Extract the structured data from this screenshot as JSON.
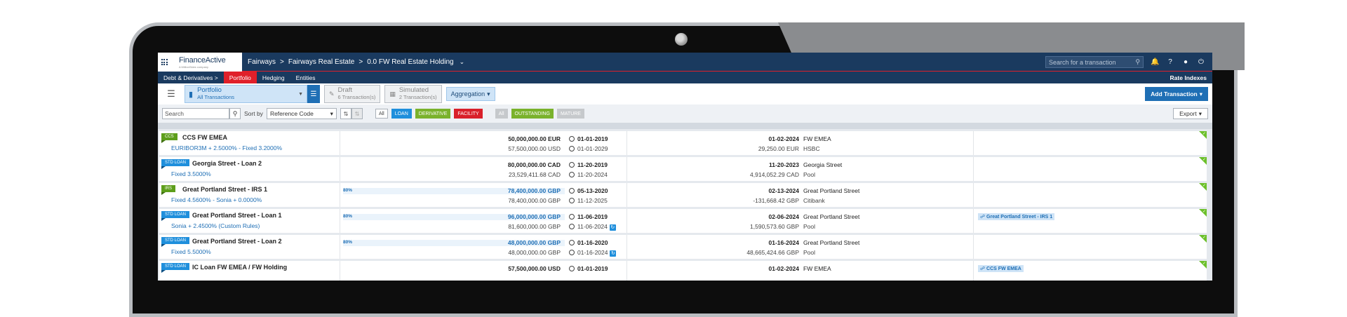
{
  "app": {
    "logo_main": "FinanceActive",
    "logo_sub": "A MillionSkies company"
  },
  "breadcrumb": [
    "Fairways",
    "Fairways Real Estate",
    "0.0 FW Real Estate Holding"
  ],
  "topbar": {
    "search_placeholder": "Search for a transaction"
  },
  "nav": {
    "items": [
      "Debt & Derivatives",
      "Portfolio",
      "Hedging",
      "Entities"
    ],
    "right": "Rate Indexes"
  },
  "toolbar": {
    "portfolio_title": "Portfolio",
    "portfolio_sub": "All Transactions",
    "draft_title": "Draft",
    "draft_sub": "6 Transaction(s)",
    "simulated_title": "Simulated",
    "simulated_sub": "2 Transaction(s)",
    "aggregation": "Aggregation",
    "add_transaction": "Add Transaction"
  },
  "filters": {
    "search_placeholder": "Search",
    "sort_label": "Sort by",
    "sort_value": "Reference Code",
    "type_chips": [
      "All",
      "LOAN",
      "DERIVATIVE",
      "FACILITY"
    ],
    "status_chips": [
      "All",
      "OUTSTANDING",
      "MATURE"
    ],
    "export": "Export"
  },
  "colors": {
    "navy": "#1a3a5f",
    "red": "#e0202a",
    "blue": "#1f6fb5",
    "green": "#6cc02a"
  },
  "rows": [
    {
      "badge": "CCS",
      "badge_color": "green",
      "name": "CCS FW EMEA",
      "rate": "EURIBOR3M + 2.5000% - Fixed 3.2000%",
      "pct": "",
      "amount1": "50,000,000.00 EUR",
      "amount2": "57,500,000.00 USD",
      "amount1_blue": false,
      "date1": "01-01-2019",
      "date2": "01-01-2029",
      "date2_refresh": false,
      "end1": "01-02-2024",
      "end2": "29,250.00 EUR",
      "cp1": "FW EMEA",
      "cp2": "HSBC",
      "link": ""
    },
    {
      "badge": "STD LOAN",
      "badge_color": "blue",
      "name": "Georgia Street - Loan 2",
      "rate": "Fixed 3.5000%",
      "pct": "",
      "amount1": "80,000,000.00 CAD",
      "amount2": "23,529,411.68 CAD",
      "amount1_blue": false,
      "date1": "11-20-2019",
      "date2": "11-20-2024",
      "date2_refresh": false,
      "end1": "11-20-2023",
      "end2": "4,914,052.29 CAD",
      "cp1": "Georgia Street",
      "cp2": "Pool",
      "link": ""
    },
    {
      "badge": "IRS",
      "badge_color": "green",
      "name": "Great Portland Street - IRS 1",
      "rate": "Fixed 4.5600% - Sonia + 0.0000%",
      "pct": "80%",
      "amount1": "78,400,000.00 GBP",
      "amount2": "78,400,000.00 GBP",
      "amount1_blue": true,
      "date1": "05-13-2020",
      "date2": "11-12-2025",
      "date2_refresh": false,
      "end1": "02-13-2024",
      "end2": "-131,668.42 GBP",
      "cp1": "Great Portland Street",
      "cp2": "Citibank",
      "link": ""
    },
    {
      "badge": "STD LOAN",
      "badge_color": "blue",
      "name": "Great Portland Street - Loan 1",
      "rate": "Sonia + 2.4500% (Custom Rules)",
      "pct": "80%",
      "amount1": "96,000,000.00 GBP",
      "amount2": "81,600,000.00 GBP",
      "amount1_blue": true,
      "date1": "11-06-2019",
      "date2": "11-06-2024",
      "date2_refresh": true,
      "end1": "02-06-2024",
      "end2": "1,590,573.60 GBP",
      "cp1": "Great Portland Street",
      "cp2": "Pool",
      "link": "Great Portland Street - IRS 1"
    },
    {
      "badge": "STD LOAN",
      "badge_color": "blue",
      "name": "Great Portland Street - Loan 2",
      "rate": "Fixed 5.5000%",
      "pct": "80%",
      "amount1": "48,000,000.00 GBP",
      "amount2": "48,000,000.00 GBP",
      "amount1_blue": true,
      "date1": "01-16-2020",
      "date2": "01-16-2024",
      "date2_refresh": true,
      "end1": "01-16-2024",
      "end2": "48,665,424.66 GBP",
      "cp1": "Great Portland Street",
      "cp2": "Pool",
      "link": ""
    },
    {
      "badge": "STD LOAN",
      "badge_color": "blue",
      "name": "IC Loan FW EMEA / FW Holding",
      "rate": "",
      "pct": "",
      "amount1": "57,500,000.00 USD",
      "amount2": "",
      "amount1_blue": false,
      "date1": "01-01-2019",
      "date2": "",
      "date2_refresh": false,
      "end1": "01-02-2024",
      "end2": "",
      "cp1": "FW EMEA",
      "cp2": "",
      "link": "CCS FW EMEA"
    }
  ]
}
